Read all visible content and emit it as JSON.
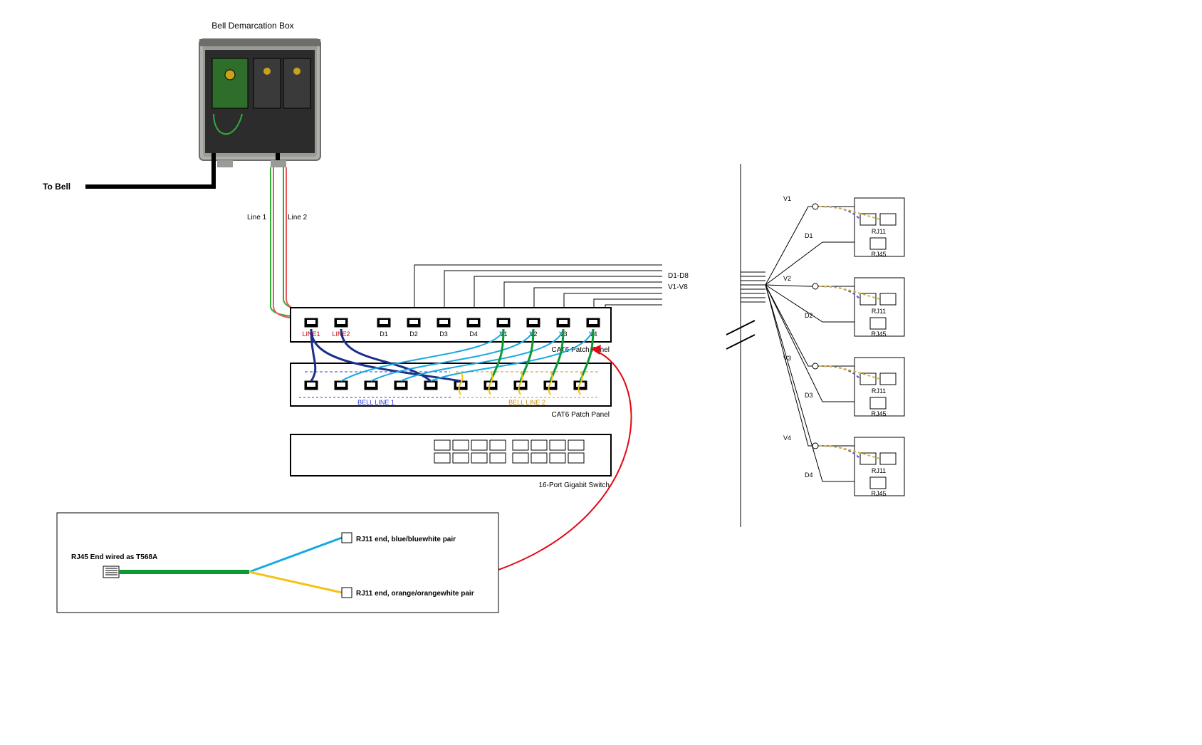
{
  "title": "Bell Demarcation Box",
  "toBell": "To Bell",
  "line1": "Line 1",
  "line2": "Line 2",
  "patchPanel1": {
    "label": "CAT6 Patch Panel",
    "ports": [
      "LINE1",
      "LINE2",
      "D1",
      "D2",
      "D3",
      "D4",
      "V1",
      "V2",
      "V3",
      "V4"
    ]
  },
  "patchPanel2": {
    "label": "CAT6 Patch Panel",
    "bellLine1": "BELL LINE 1",
    "bellLine2": "BELL LINE 2"
  },
  "switch": {
    "label": "16-Port Gigabit Switch"
  },
  "cableRuns": {
    "d": "D1-D8",
    "v": "V1-V8"
  },
  "legend": {
    "rj45": "RJ45 End wired as T568A",
    "rj11blue": "RJ11 end, blue/bluewhite pair",
    "rj11orange": "RJ11 end, orange/orangewhite pair"
  },
  "wallPlates": [
    {
      "v": "V1",
      "d": "D1"
    },
    {
      "v": "V2",
      "d": "D2"
    },
    {
      "v": "V3",
      "d": "D3"
    },
    {
      "v": "V4",
      "d": "D4"
    }
  ],
  "jack": {
    "rj11": "RJ11",
    "rj45": "RJ45"
  },
  "colors": {
    "darkBlue": "#1b2f8a",
    "cyan": "#18a9e0",
    "green": "#0a9a34",
    "yellow": "#f3c317",
    "red": "#e30613",
    "lineGreen": "#2fae3a",
    "lineRed": "#e85c5c",
    "boxGrey": "#a9aaa6",
    "boxDark": "#2c2c2c",
    "pcbGreen": "#2f6e2a"
  }
}
